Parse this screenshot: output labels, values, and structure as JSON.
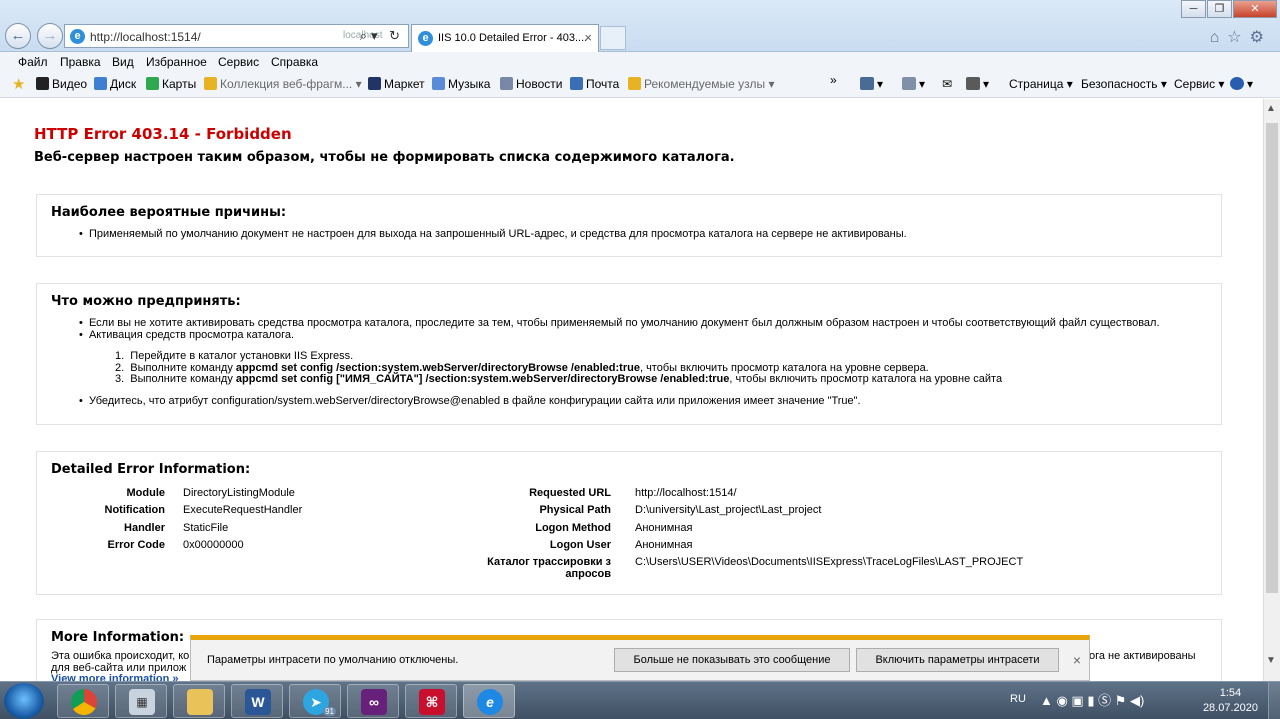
{
  "browser": {
    "address_url": "http://localhost:1514/",
    "address_ghost": "localhost",
    "tab_title": "IIS 10.0 Detailed Error - 403....",
    "address_actions": "⌕▾ ↻"
  },
  "menu": [
    "Файл",
    "Правка",
    "Вид",
    "Избранное",
    "Сервис",
    "Справка"
  ],
  "favorites": [
    {
      "label": "Видео",
      "color": "#222222"
    },
    {
      "label": "Диск",
      "color": "#3f7fd1"
    },
    {
      "label": "Карты",
      "color": "#2fa84f"
    },
    {
      "label": "Коллекция веб-фрагм... ▾",
      "color": "#e8b323"
    },
    {
      "label": "Маркет",
      "color": "#223366"
    },
    {
      "label": "Музыка",
      "color": "#5a8bd6"
    },
    {
      "label": "Новости",
      "color": "#7a88a8"
    },
    {
      "label": "Почта",
      "color": "#3a6fb5"
    },
    {
      "label": "Рекомендуемые узлы ▾",
      "color": "#e8b323"
    }
  ],
  "commands": {
    "page": "Страница ▾",
    "safety": "Безопасность ▾",
    "tools": "Сервис ▾",
    "help": "▾"
  },
  "page": {
    "title": "HTTP Error 403.14 - Forbidden",
    "subtitle": "Веб-сервер настроен таким образом, чтобы не формировать списка содержимого каталога.",
    "causes": {
      "heading": "Наиболее вероятные причины:",
      "items": [
        "Применяемый по умолчанию документ не настроен для выхода на запрошенный URL-адрес, и средства для просмотра каталога на сервере не активированы."
      ]
    },
    "actions": {
      "heading": "Что можно предпринять:",
      "item1": "Если вы не хотите активировать средства просмотра каталога, проследите за тем, чтобы применяемый по умолчанию документ был должным образом настроен и чтобы соответствующий файл существовал.",
      "item2": "Активация средств просмотра каталога.",
      "step1": "Перейдите в каталог установки IIS Express.",
      "step2_pre": "Выполните команду ",
      "step2_cmd": "appcmd set config /section:system.webServer/directoryBrowse /enabled:true",
      "step2_post": ", чтобы включить просмотр каталога на уровне сервера.",
      "step3_pre": "Выполните команду ",
      "step3_cmd": "appcmd set config [\"ИМЯ_САЙТА\"] /section:system.webServer/directoryBrowse /enabled:true",
      "step3_post": ", чтобы включить просмотр каталога на уровне сайта",
      "item3": "Убедитесь, что атрибут configuration/system.webServer/directoryBrowse@enabled в файле конфигурации сайта или приложения имеет значение \"True\"."
    },
    "details": {
      "heading": "Detailed Error Information:",
      "left": [
        {
          "label": "Module",
          "value": "DirectoryListingModule"
        },
        {
          "label": "Notification",
          "value": "ExecuteRequestHandler"
        },
        {
          "label": "Handler",
          "value": "StaticFile"
        },
        {
          "label": "Error Code",
          "value": "0x00000000"
        }
      ],
      "right": [
        {
          "label": "Requested URL",
          "value": "http://localhost:1514/"
        },
        {
          "label": "Physical Path",
          "value": "D:\\university\\Last_project\\Last_project"
        },
        {
          "label": "Logon Method",
          "value": "Анонимная"
        },
        {
          "label": "Logon User",
          "value": "Анонимная"
        },
        {
          "label": "Каталог трассировки з апросов",
          "value": "C:\\Users\\USER\\Videos\\Documents\\IISExpress\\TraceLogFiles\\LAST_PROJECT"
        }
      ]
    },
    "more": {
      "heading": "More Information:",
      "line1": "Эта ошибка происходит, ко",
      "line1_tail": "ога не активированы",
      "line2": "для веб-сайта или прилож",
      "link": "View more information »"
    }
  },
  "notification": {
    "message": "Параметры интрасети по умолчанию отключены.",
    "dont_show": "Больше не показывать это сообщение",
    "enable": "Включить параметры интрасети"
  },
  "taskbar": {
    "lang": "RU",
    "time": "1:54",
    "date": "28.07.2020",
    "telegram_badge": "91"
  }
}
